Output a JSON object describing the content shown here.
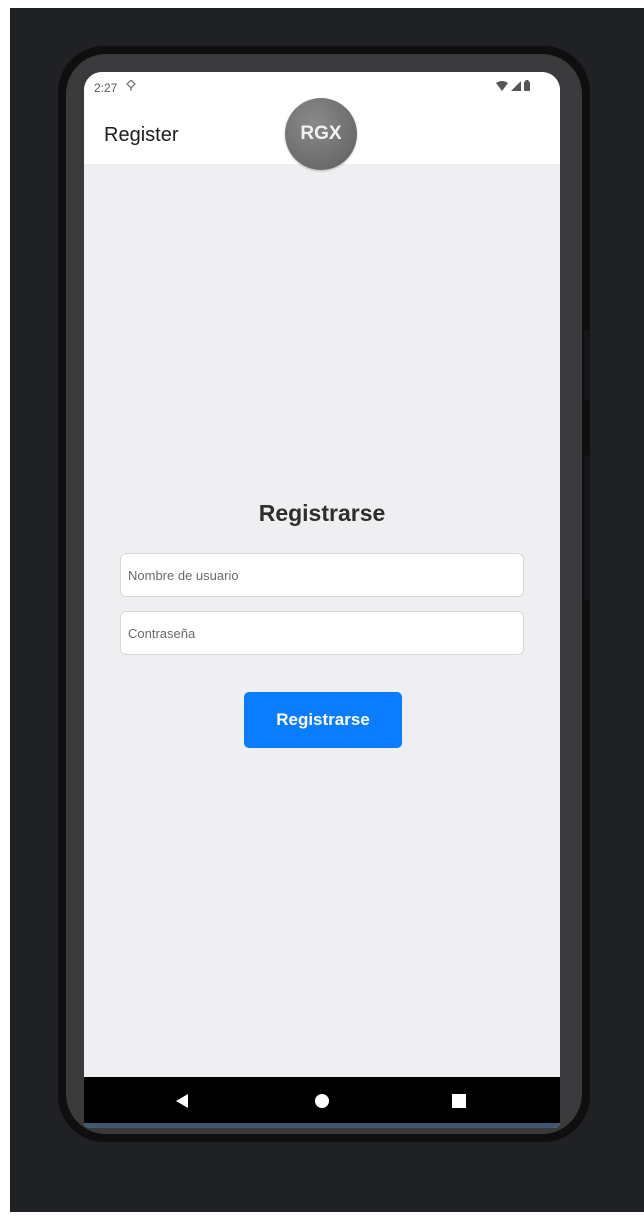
{
  "status_bar": {
    "time": "2:27",
    "notification_icon": "notification-icon",
    "system_icons": [
      "wifi-icon",
      "signal-icon",
      "battery-icon"
    ]
  },
  "app_bar": {
    "title": "Register",
    "logo_text": "RGX"
  },
  "form": {
    "heading": "Registrarse",
    "username_placeholder": "Nombre de usuario",
    "username_value": "",
    "password_placeholder": "Contraseña",
    "password_value": "",
    "submit_label": "Registrarse"
  },
  "nav_bar": {
    "buttons": [
      "back-icon",
      "home-icon",
      "recents-icon"
    ]
  },
  "colors": {
    "primary_button": "#0a7cff",
    "screen_background": "#efeef1",
    "frame_background": "#202124"
  }
}
